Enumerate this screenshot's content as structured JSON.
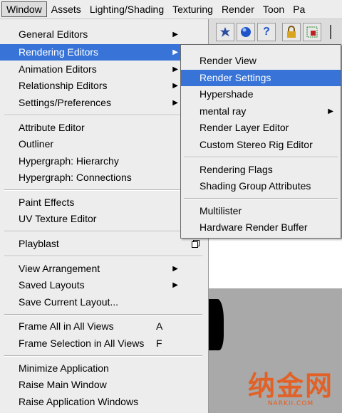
{
  "menubar": {
    "items": [
      "Window",
      "Assets",
      "Lighting/Shading",
      "Texturing",
      "Render",
      "Toon",
      "Pa"
    ]
  },
  "window_menu": {
    "items": [
      {
        "label": "General Editors",
        "submenu": true
      },
      {
        "label": "Rendering Editors",
        "submenu": true,
        "highlighted": true
      },
      {
        "label": "Animation Editors",
        "submenu": true
      },
      {
        "label": "Relationship Editors",
        "submenu": true
      },
      {
        "label": "Settings/Preferences",
        "submenu": true
      },
      {
        "label": "Attribute Editor"
      },
      {
        "label": "Outliner"
      },
      {
        "label": "Hypergraph: Hierarchy"
      },
      {
        "label": "Hypergraph: Connections"
      },
      {
        "label": "Paint Effects"
      },
      {
        "label": "UV Texture Editor"
      },
      {
        "label": "Playblast",
        "option_box": true
      },
      {
        "label": "View Arrangement",
        "submenu": true
      },
      {
        "label": "Saved Layouts",
        "submenu": true
      },
      {
        "label": "Save Current Layout..."
      },
      {
        "label": "Frame All in All Views",
        "shortcut": "A"
      },
      {
        "label": "Frame Selection in All Views",
        "shortcut": "F"
      },
      {
        "label": "Minimize Application"
      },
      {
        "label": "Raise Main Window"
      },
      {
        "label": "Raise Application Windows"
      }
    ]
  },
  "rendering_submenu": {
    "items": [
      {
        "label": "Render View"
      },
      {
        "label": "Render Settings",
        "highlighted": true
      },
      {
        "label": "Hypershade"
      },
      {
        "label": "mental ray",
        "submenu": true
      },
      {
        "label": "Render Layer Editor"
      },
      {
        "label": "Custom Stereo Rig Editor"
      },
      {
        "label": "Rendering Flags"
      },
      {
        "label": "Shading Group Attributes"
      },
      {
        "label": "Multilister"
      },
      {
        "label": "Hardware Render Buffer"
      }
    ]
  },
  "watermark": {
    "brand": "纳金网",
    "site": "NARKII.COM"
  },
  "colors": {
    "highlight": "#3874d8",
    "menu_bg": "#ededed",
    "watermark": "#e85a1a"
  }
}
